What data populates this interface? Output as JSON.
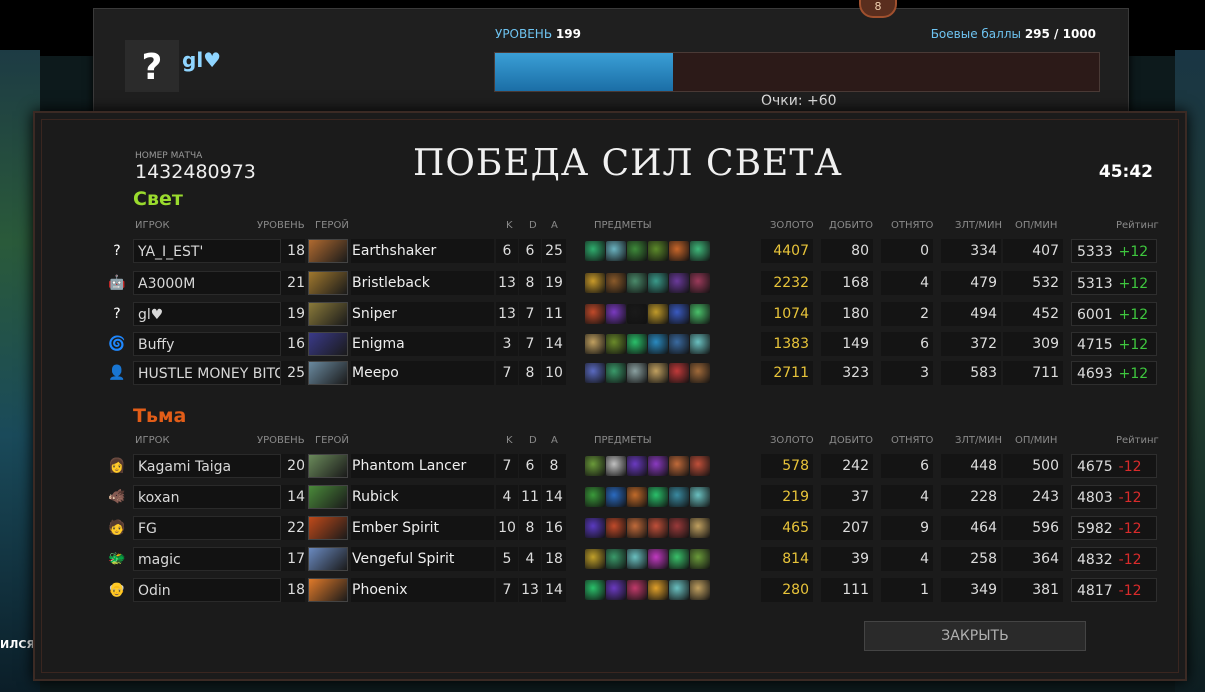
{
  "header": {
    "badge": "8",
    "avatar_glyph": "?",
    "player_name": "gl♥",
    "level_label": "УРОВЕНЬ",
    "level_value": "199",
    "battle_label": "Боевые баллы",
    "battle_value": "295 / 1000",
    "battle_progress": 0.295,
    "points": "Очки: +60"
  },
  "match": {
    "id_label": "НОМЕР МАТЧА",
    "id": "1432480973",
    "title": "ПОБЕДА СИЛ СВЕТА",
    "duration": "45:42"
  },
  "columns": {
    "player": "ИГРОК",
    "level": "УРОВЕНЬ",
    "hero": "ГЕРОЙ",
    "k": "K",
    "d": "D",
    "a": "A",
    "items": "ПРЕДМЕТЫ",
    "gold": "ЗОЛОТО",
    "last_hits": "ДОБИТО",
    "denies": "ОТНЯТО",
    "gpm": "ЗЛТ/МИН",
    "xpm": "ОП/МИН",
    "rating": "Рейтинг"
  },
  "radiant": {
    "title": "Свет",
    "players": [
      {
        "avatar": "?",
        "name": "YA_I_EST'",
        "level": "18",
        "hero": "Earthshaker",
        "k": "6",
        "d": "6",
        "a": "25",
        "gold": "4407",
        "lh": "80",
        "dn": "0",
        "gpm": "334",
        "xpm": "407",
        "rating": "5333",
        "delta": "+12",
        "hero_color": "#b06a30",
        "items": [
          "#2fae6e",
          "#6ab3c0",
          "#3e8a3a",
          "#5c8a2a",
          "#c8662a",
          "#3fb87a"
        ]
      },
      {
        "avatar": "🤖",
        "name": "A3000M",
        "level": "21",
        "hero": "Bristleback",
        "k": "13",
        "d": "8",
        "a": "19",
        "gold": "2232",
        "lh": "168",
        "dn": "4",
        "gpm": "479",
        "xpm": "532",
        "rating": "5313",
        "delta": "+12",
        "hero_color": "#a0782e",
        "items": [
          "#c89a2a",
          "#8a5a2a",
          "#4a8a6a",
          "#3a9a8a",
          "#6a3a9a",
          "#9a3a5a"
        ]
      },
      {
        "avatar": "?",
        "name": "gl♥",
        "level": "19",
        "hero": "Sniper",
        "k": "13",
        "d": "7",
        "a": "11",
        "gold": "1074",
        "lh": "180",
        "dn": "2",
        "gpm": "494",
        "xpm": "452",
        "rating": "6001",
        "delta": "+12",
        "hero_color": "#8a7a3a",
        "items": [
          "#c04a2a",
          "#7a3ac0",
          "#1a1a1a",
          "#c09a2a",
          "#3a5ac0",
          "#4ac06a"
        ]
      },
      {
        "avatar": "🌀",
        "name": "Buffy",
        "level": "16",
        "hero": "Enigma",
        "k": "3",
        "d": "7",
        "a": "14",
        "gold": "1383",
        "lh": "149",
        "dn": "6",
        "gpm": "372",
        "xpm": "309",
        "rating": "4715",
        "delta": "+12",
        "hero_color": "#3a3a8a",
        "items": [
          "#c0a060",
          "#6a8a2a",
          "#2ac06a",
          "#2a8ac0",
          "#3a6aa0",
          "#6ac0c0"
        ]
      },
      {
        "avatar": "👤",
        "name": "HUSTLE MONEY BITCH",
        "level": "25",
        "hero": "Meepo",
        "k": "7",
        "d": "8",
        "a": "10",
        "gold": "2711",
        "lh": "323",
        "dn": "3",
        "gpm": "583",
        "xpm": "711",
        "rating": "4693",
        "delta": "+12",
        "hero_color": "#6a8aa0",
        "items": [
          "#5a6ac0",
          "#3a9a6a",
          "#8aa0a0",
          "#c0a060",
          "#c03a3a",
          "#a06a3a"
        ]
      }
    ]
  },
  "dire": {
    "title": "Тьма",
    "players": [
      {
        "avatar": "👩",
        "name": "Kagami Taiga",
        "level": "20",
        "hero": "Phantom Lancer",
        "k": "7",
        "d": "6",
        "a": "8",
        "gold": "578",
        "lh": "242",
        "dn": "6",
        "gpm": "448",
        "xpm": "500",
        "rating": "4675",
        "delta": "-12",
        "hero_color": "#6a8a5a",
        "items": [
          "#6a9a3a",
          "#c0c0c0",
          "#6a3ac0",
          "#8a3ac0",
          "#c06a3a",
          "#c0503a"
        ]
      },
      {
        "avatar": "🐗",
        "name": "koxan",
        "level": "14",
        "hero": "Rubick",
        "k": "4",
        "d": "11",
        "a": "14",
        "gold": "219",
        "lh": "37",
        "dn": "4",
        "gpm": "228",
        "xpm": "243",
        "rating": "4803",
        "delta": "-12",
        "hero_color": "#4a8a3a",
        "items": [
          "#3a9a3a",
          "#2a6ac0",
          "#c06a2a",
          "#2ac06a",
          "#3a8aa0",
          "#6ac0c0"
        ]
      },
      {
        "avatar": "🧑",
        "name": "FG",
        "level": "22",
        "hero": "Ember Spirit",
        "k": "10",
        "d": "8",
        "a": "16",
        "gold": "465",
        "lh": "207",
        "dn": "9",
        "gpm": "464",
        "xpm": "596",
        "rating": "5982",
        "delta": "-12",
        "hero_color": "#c04a1a",
        "items": [
          "#5a3ac0",
          "#c04a2a",
          "#c06a3a",
          "#c0503a",
          "#9a3a3a",
          "#c0a060"
        ]
      },
      {
        "avatar": "🐲",
        "name": "magic",
        "level": "17",
        "hero": "Vengeful Spirit",
        "k": "5",
        "d": "4",
        "a": "18",
        "gold": "814",
        "lh": "39",
        "dn": "4",
        "gpm": "258",
        "xpm": "364",
        "rating": "4832",
        "delta": "-12",
        "hero_color": "#6a8ac0",
        "items": [
          "#c0a02a",
          "#3a9a6a",
          "#6ac0c0",
          "#c03ac0",
          "#3ac06a",
          "#6a9a3a"
        ]
      },
      {
        "avatar": "👴",
        "name": "Odin",
        "level": "18",
        "hero": "Phoenix",
        "k": "7",
        "d": "13",
        "a": "14",
        "gold": "280",
        "lh": "111",
        "dn": "1",
        "gpm": "349",
        "xpm": "381",
        "rating": "4817",
        "delta": "-12",
        "hero_color": "#e07a2a",
        "items": [
          "#2ac06a",
          "#6a3ac0",
          "#c03a6a",
          "#e0a02a",
          "#6ac0c0",
          "#c0a060"
        ]
      }
    ]
  },
  "close_button": "ЗАКРЫТЬ",
  "edge_text": "ИЛСЯ"
}
